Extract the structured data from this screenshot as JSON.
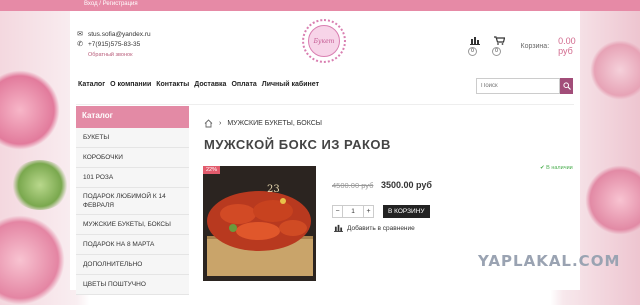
{
  "topbar": {
    "links": "Вход / Регистрация"
  },
  "contacts": {
    "email": "stus.sofia@yandex.ru",
    "phone": "+7(915)575-83-35",
    "callback": "Обратный звонок"
  },
  "logo": {
    "text": "Букет"
  },
  "header": {
    "compare_count": "0",
    "cart_count": "0",
    "cart_label": "Корзина:",
    "cart_total": "0.00 руб"
  },
  "nav": {
    "items": [
      "Каталог",
      "О компании",
      "Контакты",
      "Доставка",
      "Оплата",
      "Личный кабинет"
    ]
  },
  "search": {
    "placeholder": "Поиск"
  },
  "sidebar": {
    "title": "Каталог",
    "items": [
      "БУКЕТЫ",
      "КОРОБОЧКИ",
      "101 РОЗА",
      "ПОДАРОК ЛЮБИМОЙ К 14 ФЕВРАЛЯ",
      "МУЖСКИЕ БУКЕТЫ, БОКСЫ",
      "ПОДАРОК НА 8 МАРТА",
      "ДОПОЛНИТЕЛЬНО",
      "ЦВЕТЫ ПОШТУЧНО"
    ]
  },
  "breadcrumb": {
    "current": "МУЖСКИЕ БУКЕТЫ, БОКСЫ"
  },
  "product": {
    "title": "МУЖСКОЙ БОКС ИЗ РАКОВ",
    "discount": "22%",
    "stock": "В наличии",
    "old_price": "4500.00 руб",
    "new_price": "3500.00 руб",
    "quantity": "1",
    "add_to_cart": "В КОРЗИНУ",
    "compare": "Добавить в сравнение"
  },
  "watermark": "YAPLAKAL.COM",
  "colors": {
    "accent": "#e38aa5",
    "brand": "#a24d79"
  }
}
